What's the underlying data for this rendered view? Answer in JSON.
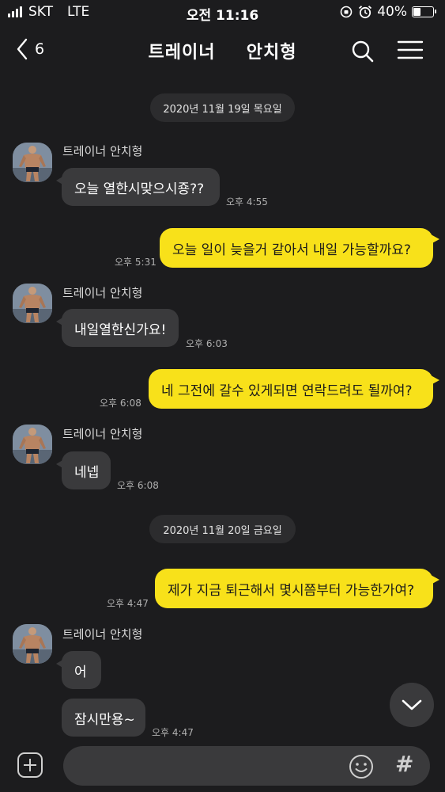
{
  "status_bar": {
    "carrier": "SKT",
    "network": "LTE",
    "time": "오전 11:16",
    "battery_percent_label": "40%",
    "battery_level": 0.4
  },
  "nav": {
    "back_count": "6",
    "title_part1": "트레이너",
    "title_part2": "안치형"
  },
  "chat": {
    "date_divider_1": "2020년 11월 19일 목요일",
    "date_divider_2": "2020년 11월 20일 금요일",
    "messages": [
      {
        "sender": "트레이너   안치형",
        "text": "오늘 열한시맞으시죵??",
        "time": "오후 4:55"
      },
      {
        "text": "오늘 일이 늦을거 같아서 내일 가능할까요?",
        "time": "오후 5:31"
      },
      {
        "sender": "트레이너   안치형",
        "text": "내일열한신가요!",
        "time": "오후 6:03"
      },
      {
        "text": "네 그전에 갈수 있게되면 연락드려도 될까여?",
        "time": "오후 6:08"
      },
      {
        "sender": "트레이너   안치형",
        "text": "네넵",
        "time": "오후 6:08"
      },
      {
        "text": "제가 지금 퇴근해서 몇시쯤부터 가능한가여?",
        "time": "오후 4:47"
      },
      {
        "sender": "트레이너   안치형",
        "text": "어"
      },
      {
        "text": "잠시만용~",
        "time": "오후 4:47"
      }
    ]
  },
  "input": {
    "placeholder": "",
    "hash_label": "#"
  },
  "colors": {
    "background": "#1c1c1e",
    "incoming_bubble": "#3a3a3c",
    "outgoing_bubble": "#f8e11a"
  }
}
